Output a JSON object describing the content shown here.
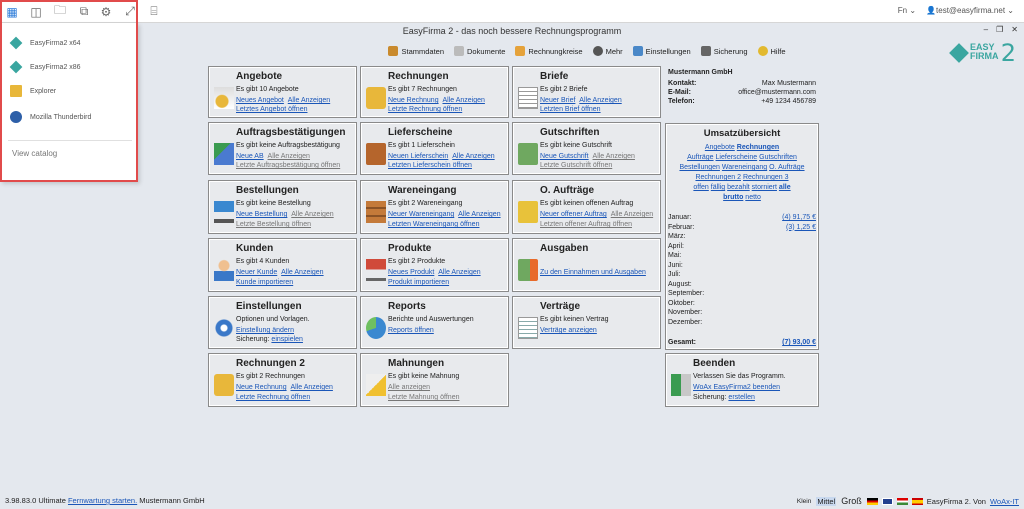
{
  "window": {
    "title": "EasyFirma 2 - das noch bessere Rechnungsprogramm",
    "min": "–",
    "restore": "❐",
    "close": "✕"
  },
  "topbar": {
    "lang": "Fn",
    "user": "test@easyfirma.net"
  },
  "logo": {
    "line1": "EASY",
    "line2": "FIRMA",
    "num": "2"
  },
  "toolbar": [
    {
      "label": "Stammdaten",
      "color": "#c98a2d"
    },
    {
      "label": "Dokumente",
      "color": "#bbbbbb"
    },
    {
      "label": "Rechnungkreise",
      "color": "#e5a23a"
    },
    {
      "label": "Mehr",
      "color": "#555555"
    },
    {
      "label": "Einstellungen",
      "color": "#4a88c8"
    },
    {
      "label": "Sicherung",
      "color": "#666666"
    },
    {
      "label": "Hilfe",
      "color": "#e2b92f"
    }
  ],
  "panels": {
    "angebote": {
      "title": "Angebote",
      "info": "Es gibt 10 Angebote",
      "l1": "Neues Angebot",
      "l2": "Alle Anzeigen",
      "l3": "Letztes Angebot öffnen"
    },
    "rechnungen": {
      "title": "Rechnungen",
      "info": "Es gibt 7 Rechnungen",
      "l1": "Neue Rechnung",
      "l2": "Alle Anzeigen",
      "l3": "Letzte Rechnung öffnen"
    },
    "briefe": {
      "title": "Briefe",
      "info": "Es gibt 2 Briefe",
      "l1": "Neuer Brief",
      "l2": "Alle Anzeigen",
      "l3": "Letzten Brief öffnen"
    },
    "auftrag": {
      "title": "Auftragsbestätigungen",
      "info": "Es gibt keine Auftragsbestätigung",
      "l1": "Neue AB",
      "l2": "Alle Anzeigen",
      "l3": "Letzte Auftragsbestätigung öffnen"
    },
    "lieferscheine": {
      "title": "Lieferscheine",
      "info": "Es gibt 1 Lieferschein",
      "l1": "Neuen Lieferschein",
      "l2": "Alle Anzeigen",
      "l3": "Letzten Lieferschein öffnen"
    },
    "gutschriften": {
      "title": "Gutschriften",
      "info": "Es gibt keine Gutschrift",
      "l1": "Neue Gutschrift",
      "l2": "Alle Anzeigen",
      "l3": "Letzte Gutschrift öffnen"
    },
    "bestellungen": {
      "title": "Bestellungen",
      "info": "Es gibt keine Bestellung",
      "l1": "Neue Bestellung",
      "l2": "Alle Anzeigen",
      "l3": "Letzte Bestellung öffnen"
    },
    "wareneingang": {
      "title": "Wareneingang",
      "info": "Es gibt 2 Wareneingang",
      "l1": "Neuer Wareneingang",
      "l2": "Alle Anzeigen",
      "l3": "Letzten Wareneingang öffnen"
    },
    "oauftraege": {
      "title": "O. Aufträge",
      "info": "Es gibt keinen offenen Auftrag",
      "l1": "Neuer offener Auftrag",
      "l2": "Alle Anzeigen",
      "l3": "Letzten offener Auftrag öffnen"
    },
    "kunden": {
      "title": "Kunden",
      "info": "Es gibt 4 Kunden",
      "l1": "Neuer Kunde",
      "l2": "Alle Anzeigen",
      "l3": "Kunde importieren"
    },
    "produkte": {
      "title": "Produkte",
      "info": "Es gibt 2 Produkte",
      "l1": "Neues Produkt",
      "l2": "Alle Anzeigen",
      "l3": "Produkt importieren"
    },
    "ausgaben": {
      "title": "Ausgaben",
      "l1": "Zu den Einnahmen und Ausgaben"
    },
    "einstellungen": {
      "title": "Einstellungen",
      "info": "Optionen und Vorlagen.",
      "l1": "Einstellung ändern",
      "l2prefix": "Sicherung:",
      "l2": "einspielen"
    },
    "reports": {
      "title": "Reports",
      "info": "Berichte und Auswertungen",
      "l1": "Reports öffnen"
    },
    "vertraege": {
      "title": "Verträge",
      "info": "Es gibt keinen Vertrag",
      "l1": "Verträge anzeigen"
    },
    "rechnungen2": {
      "title": "Rechnungen 2",
      "info": "Es gibt 2 Rechnungen",
      "l1": "Neue Rechnung",
      "l2": "Alle Anzeigen",
      "l3": "Letzte Rechnung öffnen"
    },
    "mahnungen": {
      "title": "Mahnungen",
      "info": "Es gibt keine Mahnung",
      "l1": "Alle anzeigen",
      "l3": "Letzte Mahnung öffnen"
    },
    "beenden": {
      "title": "Beenden",
      "info": "Verlassen Sie das Programm.",
      "l1": "WoAx EasyFirma2 beenden",
      "l2prefix": "Sicherung:",
      "l2": "erstellen"
    }
  },
  "contact": {
    "company": "Mustermann GmbH",
    "rows": [
      {
        "k": "Kontakt:",
        "v": "Max Mustermann"
      },
      {
        "k": "E-Mail:",
        "v": "office@mustermann.com"
      },
      {
        "k": "Telefon:",
        "v": "+49 1234 456789"
      }
    ]
  },
  "umsatz": {
    "title": "Umsatzübersicht",
    "links": {
      "angebote": "Angebote",
      "rechnungen": "Rechnungen",
      "auftraege": "Aufträge",
      "lieferscheine": "Lieferscheine",
      "gutschriften": "Gutschriften",
      "bestellungen": "Bestellungen",
      "wareneingang": "Wareneingang",
      "oauftraege": "O. Aufträge",
      "rechnungen2": "Rechnungen 2",
      "rechnungen3": "Rechnungen 3",
      "offen": "offen",
      "faellig": "fällig",
      "bezahlt": "bezahlt",
      "storniert": "storniert",
      "alle": "alle",
      "brutto": "brutto",
      "netto": "netto"
    },
    "months": [
      {
        "m": "Januar:",
        "v": "(4)  91,75 €"
      },
      {
        "m": "Februar:",
        "v": "(3)  1,25 €"
      },
      {
        "m": "März:",
        "v": ""
      },
      {
        "m": "April:",
        "v": ""
      },
      {
        "m": "Mai:",
        "v": ""
      },
      {
        "m": "Juni:",
        "v": ""
      },
      {
        "m": "Juli:",
        "v": ""
      },
      {
        "m": "August:",
        "v": ""
      },
      {
        "m": "September:",
        "v": ""
      },
      {
        "m": "Oktober:",
        "v": ""
      },
      {
        "m": "November:",
        "v": ""
      },
      {
        "m": "Dezember:",
        "v": ""
      }
    ],
    "total_label": "Gesamt:",
    "total_value": "(7)  93,00 €"
  },
  "dropdown": {
    "items": [
      {
        "label": "EasyFirma2 x64",
        "color": "#3aa6a0"
      },
      {
        "label": "EasyFirma2 x86",
        "color": "#3aa6a0"
      },
      {
        "label": "Explorer",
        "color": "#e8b73a"
      },
      {
        "label": "Mozilla Thunderbird",
        "color": "#2d5fa8"
      }
    ],
    "catalog": "View catalog"
  },
  "footer": {
    "version": "3.98.83.0 Ultimate",
    "remote": "Fernwartung starten.",
    "company": "Mustermann GmbH",
    "size_small": "Klein",
    "size_mid": "Mittel",
    "size_big": "Groß",
    "product": "EasyFirma 2. Von",
    "vendor": "WoAx-IT"
  }
}
